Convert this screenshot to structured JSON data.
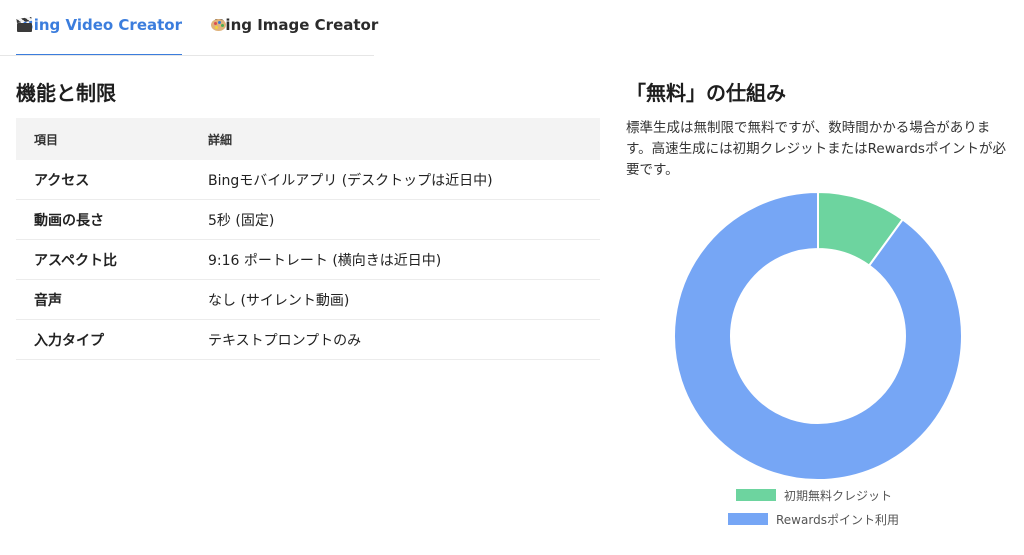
{
  "tabs": [
    {
      "label": "Bing Video Creator",
      "active": true,
      "icon": "clapperboard-icon"
    },
    {
      "label": "Bing Image Creator",
      "active": false,
      "icon": "palette-icon"
    }
  ],
  "features": {
    "title": "機能と制限",
    "columns": [
      "項目",
      "詳細"
    ],
    "rows": [
      {
        "item": "アクセス",
        "detail": "Bingモバイルアプリ (デスクトップは近日中)"
      },
      {
        "item": "動画の長さ",
        "detail": "5秒 (固定)"
      },
      {
        "item": "アスペクト比",
        "detail": "9:16 ポートレート (横向きは近日中)"
      },
      {
        "item": "音声",
        "detail": "なし (サイレント動画)"
      },
      {
        "item": "入力タイプ",
        "detail": "テキストプロンプトのみ"
      }
    ]
  },
  "pricing": {
    "title": "「無料」の仕組み",
    "description": "標準生成は無制限で無料ですが、数時間かかる場合があります。高速生成には初期クレジットまたはRewardsポイントが必要です。"
  },
  "chart_data": {
    "type": "pie",
    "donut": true,
    "title": "",
    "categories": [
      "初期無料クレジット",
      "Rewardsポイント利用"
    ],
    "values": [
      10,
      90
    ],
    "colors": [
      "#6dd49f",
      "#76a6f5"
    ],
    "legend": "bottom"
  }
}
